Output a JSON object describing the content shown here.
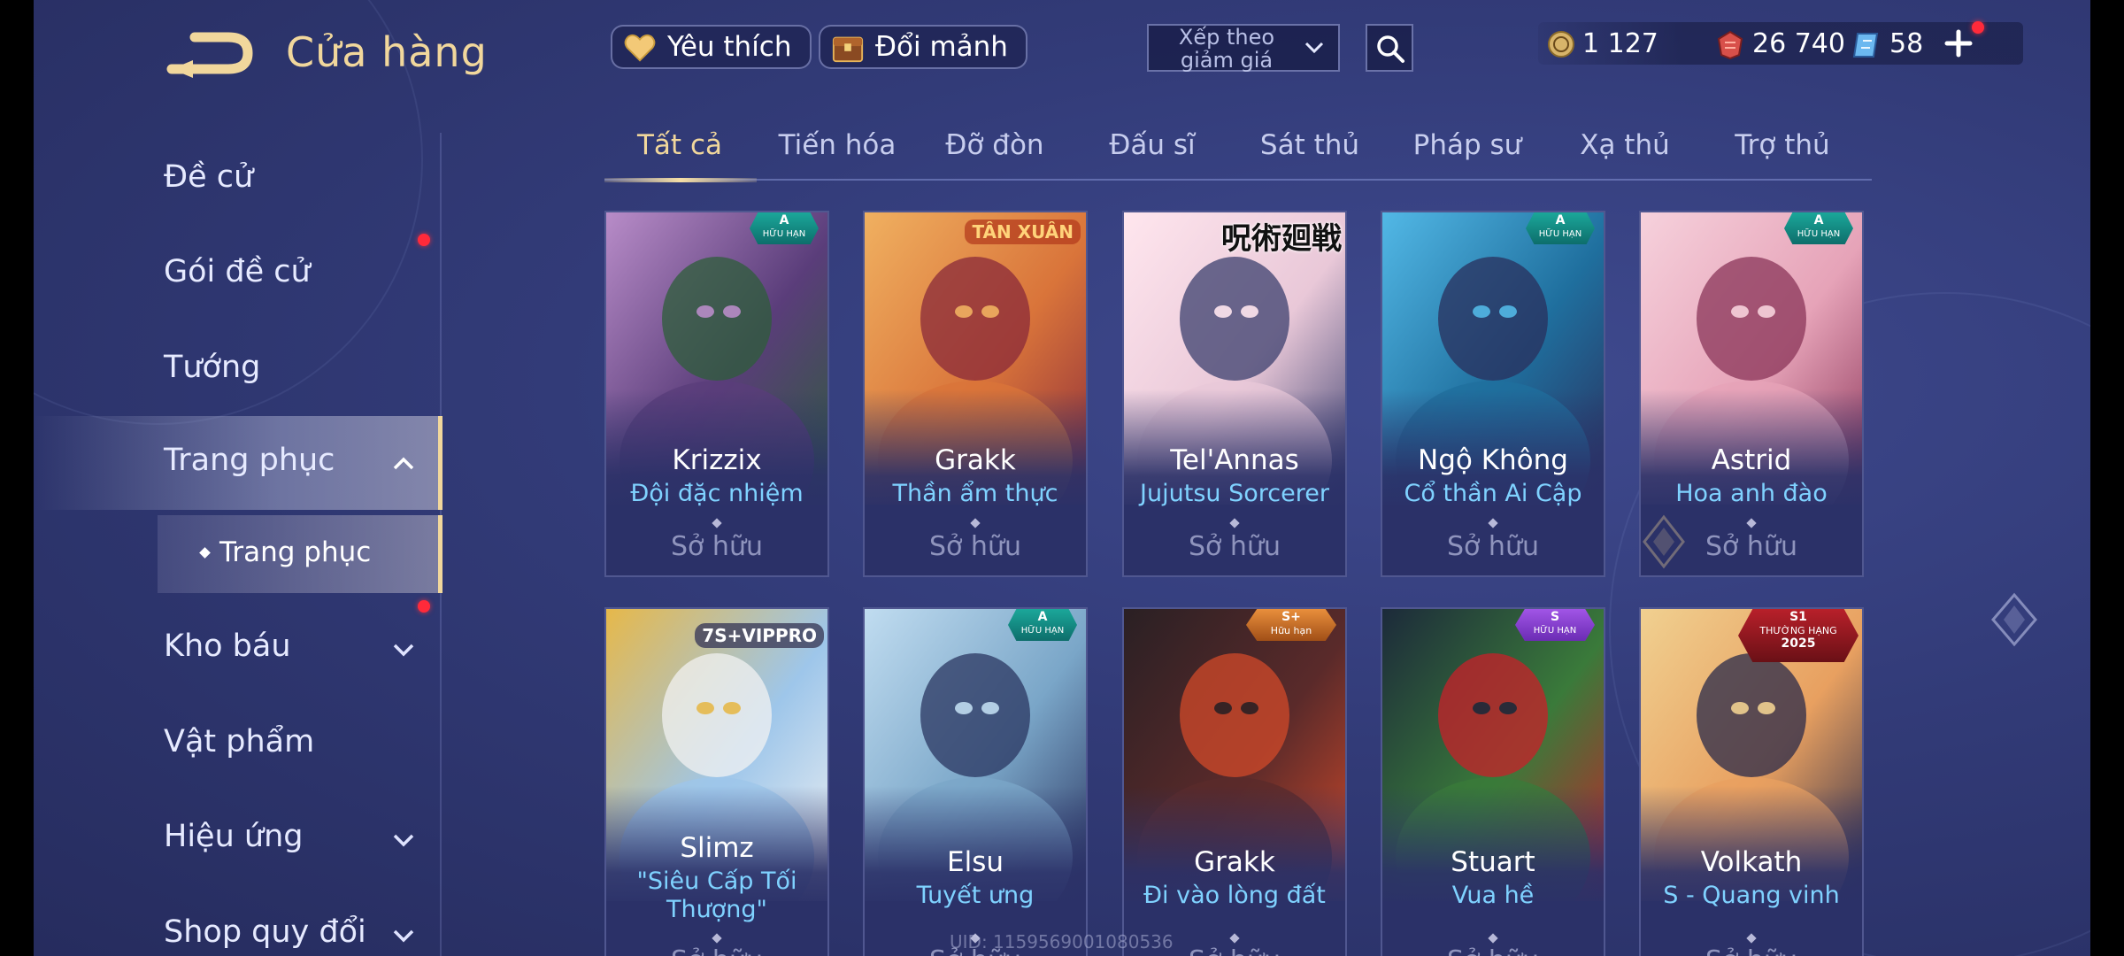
{
  "header": {
    "title": "Cửa hàng",
    "favorites_label": "Yêu thích",
    "exchange_label": "Đổi mảnh",
    "sort": {
      "selected": "Xếp theo giảm giá"
    }
  },
  "currencies": [
    {
      "icon": "gold-coin-icon",
      "value": "1 127"
    },
    {
      "icon": "red-voucher-icon",
      "value": "26 740"
    },
    {
      "icon": "blue-voucher-icon",
      "value": "58"
    }
  ],
  "sidebar": {
    "items": [
      {
        "label": "Đề cử"
      },
      {
        "label": "Gói đề cử"
      },
      {
        "label": "Tướng"
      },
      {
        "label": "Trang phục"
      },
      {
        "label": "Kho báu"
      },
      {
        "label": "Vật phẩm"
      },
      {
        "label": "Hiệu ứng"
      },
      {
        "label": "Shop quy đổi"
      }
    ],
    "sub_items": [
      {
        "label": "Trang phục"
      }
    ]
  },
  "tabs": [
    {
      "label": "Tất cả"
    },
    {
      "label": "Tiến hóa"
    },
    {
      "label": "Đỡ đòn"
    },
    {
      "label": "Đấu sĩ"
    },
    {
      "label": "Sát thủ"
    },
    {
      "label": "Pháp sư"
    },
    {
      "label": "Xạ thủ"
    },
    {
      "label": "Trợ thủ"
    }
  ],
  "cards": [
    {
      "hero": "Krizzix",
      "skin": "Đội đặc nhiệm",
      "status": "Sở hữu",
      "badge_big": "A",
      "badge_small": "HỮU HẠN",
      "colors": [
        "#5a3d7a",
        "#2e5d3a",
        "#b88cc8"
      ]
    },
    {
      "hero": "Grakk",
      "skin": "Thần ẩm thực",
      "status": "Sở hữu",
      "badge_text": "TÂN XUÂN",
      "colors": [
        "#d9743a",
        "#8a2a3a",
        "#f0b060"
      ]
    },
    {
      "hero": "Tel'Annas",
      "skin": "Jujutsu Sorcerer",
      "status": "Sở hữu",
      "badge_text": "呪術廻戦",
      "colors": [
        "#e9c8d8",
        "#3b3f6e",
        "#ffe6ee"
      ]
    },
    {
      "hero": "Ngộ Không",
      "skin": "Cổ thần Ai Cập",
      "status": "Sở hữu",
      "badge_big": "A",
      "badge_small": "HỮU HẠN",
      "colors": [
        "#1f6f9e",
        "#2a2f5c",
        "#52b8e6"
      ]
    },
    {
      "hero": "Astrid",
      "skin": "Hoa anh đào",
      "status": "Sở hữu",
      "badge_big": "A",
      "badge_small": "HỮU HẠN",
      "colors": [
        "#e6a3b8",
        "#8a3458",
        "#f6d1dc"
      ]
    },
    {
      "hero": "Slimz",
      "skin": "\"Siêu Cấp Tối Thượng\"",
      "status": "Sở hữu",
      "badge_text": "7S+VIPPRO",
      "colors": [
        "#9ec6ea",
        "#f2f2f2",
        "#e6b84a"
      ]
    },
    {
      "hero": "Elsu",
      "skin": "Tuyết ưng",
      "status": "Sở hữu",
      "badge_big": "A",
      "badge_small": "HỮU HẠN",
      "colors": [
        "#7aa6c8",
        "#2a3560",
        "#c0dcf0"
      ]
    },
    {
      "hero": "Grakk",
      "skin": "Đi vào lòng đất",
      "status": "Sở hữu",
      "badge_big": "S+",
      "badge_small": "Hữu hạn",
      "colors": [
        "#5a2a2a",
        "#d24a2a",
        "#2a2024"
      ]
    },
    {
      "hero": "Stuart",
      "skin": "Vua hề",
      "status": "Sở hữu",
      "badge_big": "S",
      "badge_small": "HỮU HẠN",
      "colors": [
        "#3a7a3a",
        "#c8202a",
        "#1c2a3a"
      ]
    },
    {
      "hero": "Volkath",
      "skin": "S - Quang vinh",
      "status": "Sở hữu",
      "badge_big": "S1",
      "badge_small": "THƯỜNG HẠNG",
      "badge_year": "2025",
      "colors": [
        "#e8a060",
        "#2a2a4a",
        "#f0d090"
      ]
    }
  ],
  "uid_text": "UID: 1159569001080536"
}
